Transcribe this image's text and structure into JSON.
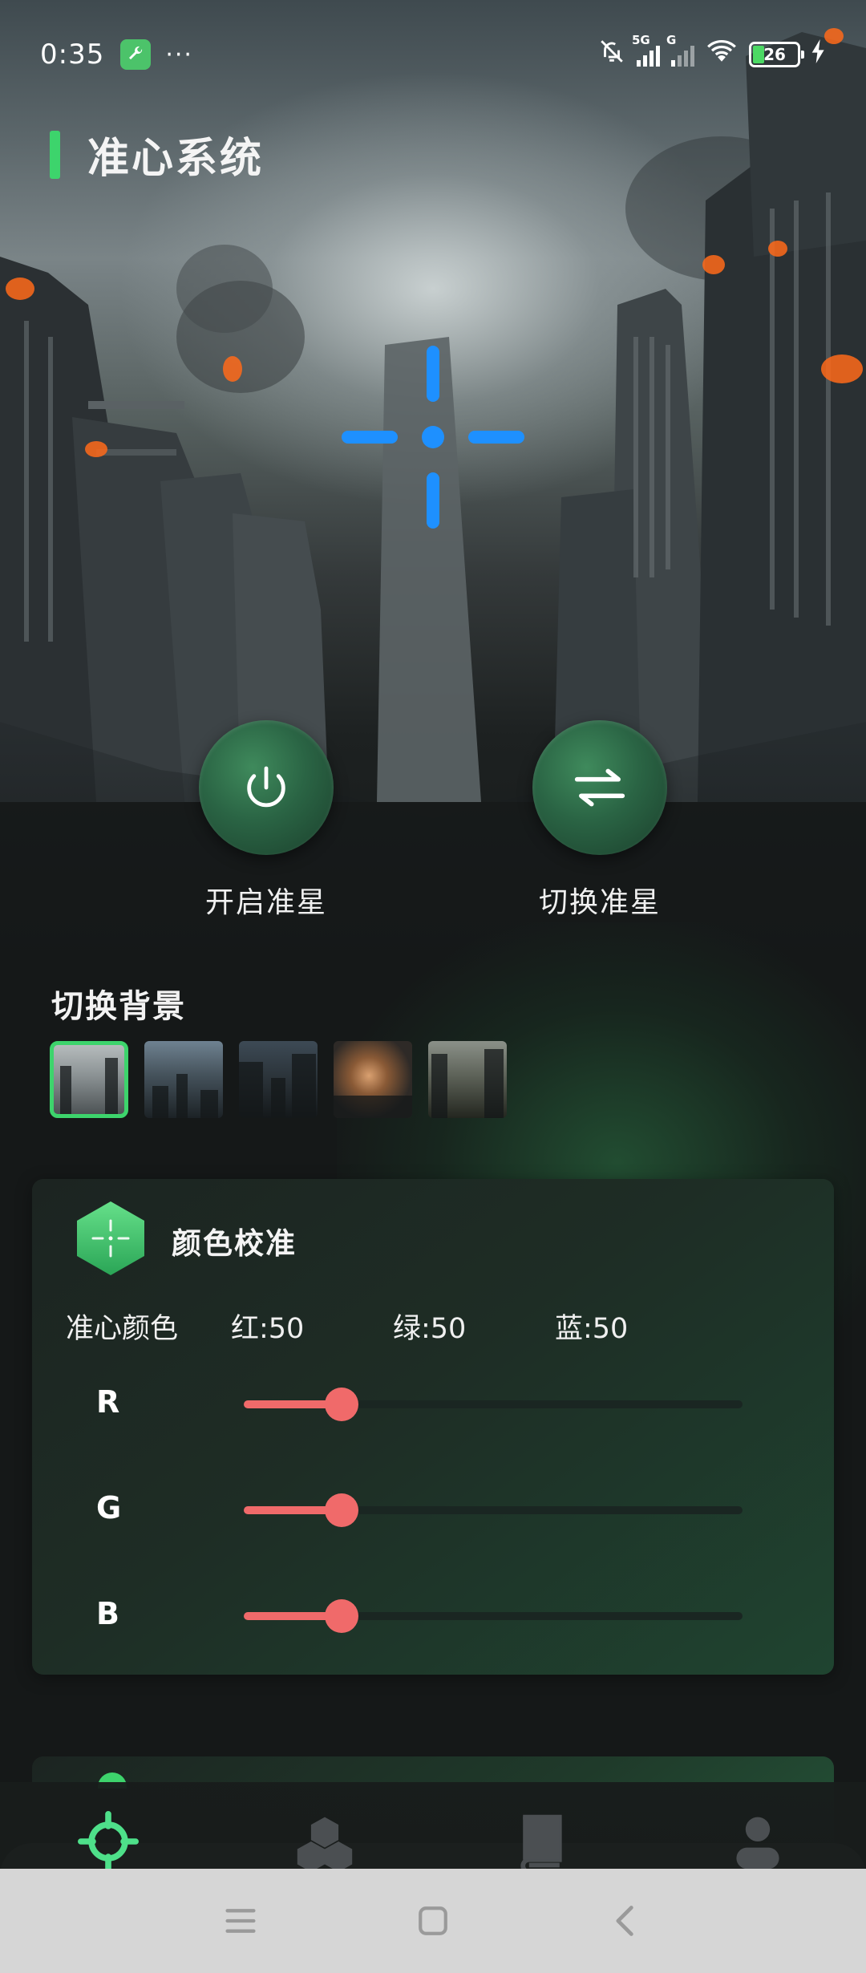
{
  "status_bar": {
    "time": "0:35",
    "dots": "···",
    "network_1": "5G",
    "network_2": "G",
    "battery": "26"
  },
  "header": {
    "title": "准心系统"
  },
  "actions": {
    "toggle_label": "开启准星",
    "switch_label": "切换准星"
  },
  "background": {
    "title": "切换背景",
    "selected_index": 0,
    "thumb_count": 5
  },
  "calibration": {
    "title": "颜色校准",
    "color_label": "准心颜色",
    "red_text": "红:50",
    "green_text": "绿:50",
    "blue_text": "蓝:50",
    "sliders": [
      {
        "label": "R",
        "value": 50,
        "max": 255
      },
      {
        "label": "G",
        "value": 50,
        "max": 255
      },
      {
        "label": "B",
        "value": 50,
        "max": 255
      }
    ],
    "slider_color": "#f06a6a"
  },
  "crosshair_color": "#1e90ff",
  "accent_color": "#3dd46c",
  "bottom_nav": {
    "items": [
      "crosshair-icon",
      "cubes-icon",
      "book-icon",
      "user-icon"
    ],
    "active_index": 0
  },
  "system_nav": {
    "buttons": [
      "menu-icon",
      "home-icon",
      "back-icon"
    ]
  }
}
